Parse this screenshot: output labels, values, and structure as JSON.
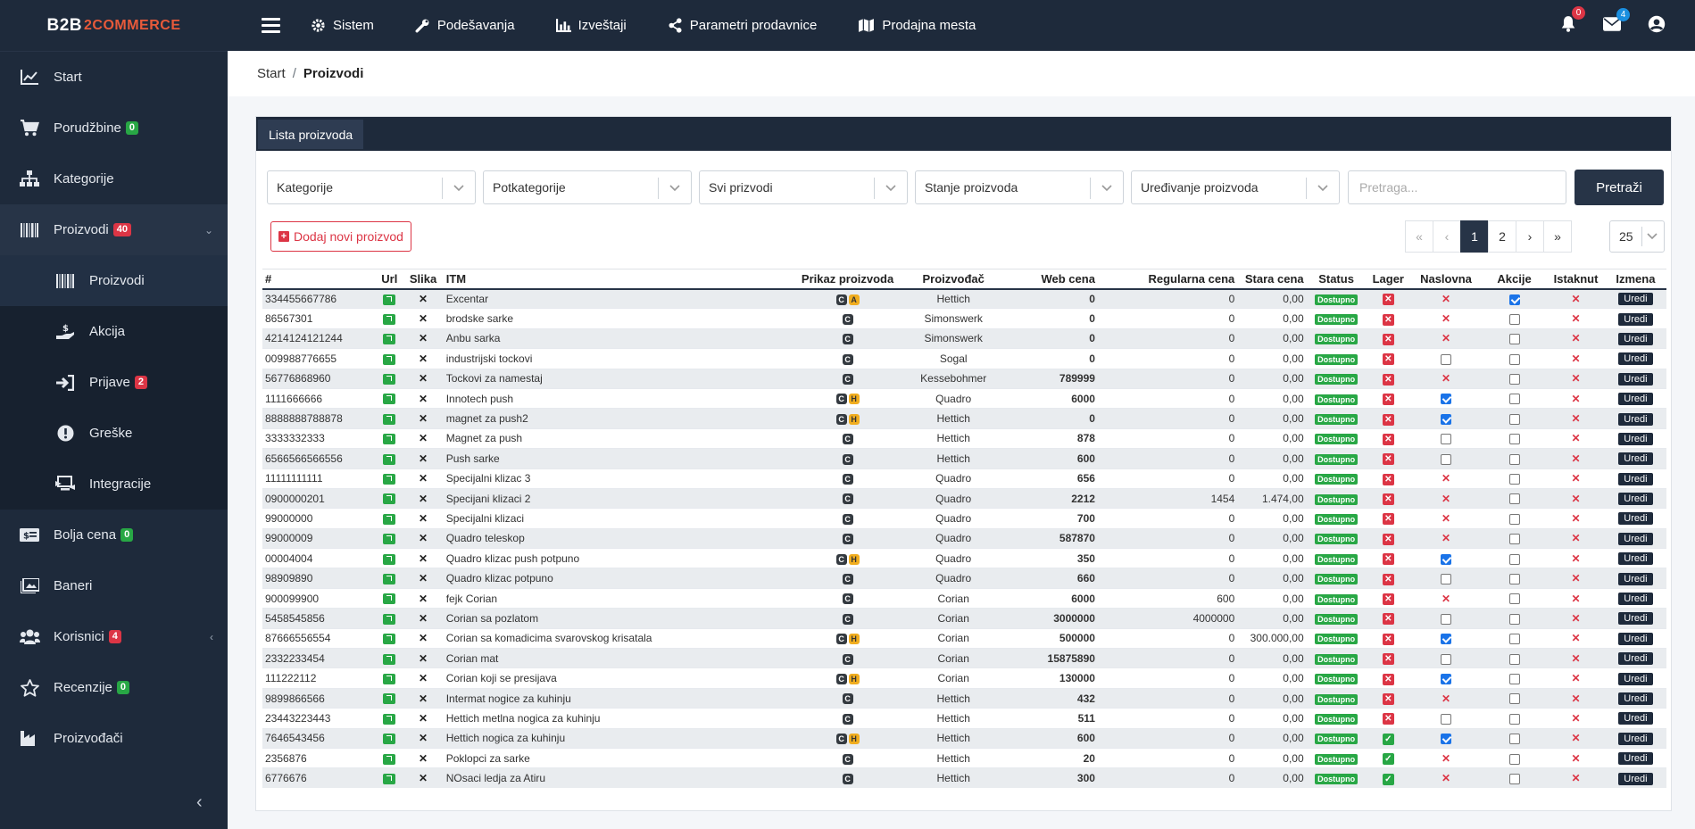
{
  "brand": {
    "part1": "B2B",
    "part2": "2COMMERCE"
  },
  "sidebar": {
    "items": [
      {
        "label": "Start",
        "icon": "chart-line-icon",
        "badge": null
      },
      {
        "label": "Porudžbine",
        "icon": "cart-icon",
        "badge": "0",
        "badge_color": "green"
      },
      {
        "label": "Kategorije",
        "icon": "sitemap-icon",
        "badge": null
      },
      {
        "label": "Proizvodi",
        "icon": "barcode-icon",
        "badge": "40",
        "badge_color": "red"
      },
      {
        "label": "Proizvodi",
        "icon": "barcode-icon",
        "badge": null
      },
      {
        "label": "Akcija",
        "icon": "hand-dollar-icon",
        "badge": null
      },
      {
        "label": "Prijave",
        "icon": "sign-in-icon",
        "badge": "2",
        "badge_color": "red"
      },
      {
        "label": "Greške",
        "icon": "exclamation-icon",
        "badge": null
      },
      {
        "label": "Integracije",
        "icon": "integration-icon",
        "badge": null
      },
      {
        "label": "Bolja cena",
        "icon": "money-icon",
        "badge": "0",
        "badge_color": "green"
      },
      {
        "label": "Baneri",
        "icon": "image-icon",
        "badge": null
      },
      {
        "label": "Korisnici",
        "icon": "users-icon",
        "badge": "4",
        "badge_color": "red"
      },
      {
        "label": "Recenzije",
        "icon": "star-icon",
        "badge": "0",
        "badge_color": "green"
      },
      {
        "label": "Proizvođači",
        "icon": "factory-icon",
        "badge": null
      }
    ]
  },
  "topbar": {
    "menu": [
      "Sistem",
      "Podešavanja",
      "Izveštaji",
      "Parametri prodavnice",
      "Prodajna mesta"
    ],
    "notifications_count": "0",
    "messages_count": "4"
  },
  "breadcrumb": {
    "home": "Start",
    "current": "Proizvodi"
  },
  "card": {
    "tab": "Lista proizvoda"
  },
  "filters": {
    "kategorije": "Kategorije",
    "potkategorije": "Potkategorije",
    "prikaz": "Svi prizvodi",
    "stanje": "Stanje proizvoda",
    "uredjivanje": "Uređivanje proizvoda",
    "search_placeholder": "Pretraga...",
    "search_button": "Pretraži"
  },
  "add_button": "Dodaj novi proizvod",
  "pagination": {
    "first": "«",
    "prev": "‹",
    "pages": [
      "1",
      "2"
    ],
    "next": "›",
    "last": "»",
    "page_size": "25"
  },
  "table": {
    "headers": [
      "#",
      "Url",
      "Slika",
      "ITM",
      "Prikaz proizvoda",
      "Proizvođač",
      "Web cena",
      "Regularna cena",
      "Stara cena",
      "Status",
      "Lager",
      "Naslovna",
      "Akcije",
      "Istaknut",
      "Izmena"
    ],
    "status_label": "Dostupno",
    "edit_label": "Uredi",
    "rows": [
      {
        "id": "334455667786",
        "name": "Excentar",
        "prikaz": [
          "C",
          "A"
        ],
        "man": "Hettich",
        "web": "0",
        "reg": "0",
        "old": "0,00",
        "lager": false,
        "nasl": "x",
        "akc": true,
        "ist": "x",
        "link": false
      },
      {
        "id": "86567301",
        "name": "brodske sarke",
        "prikaz": [
          "C"
        ],
        "man": "Simonswerk",
        "web": "0",
        "reg": "0",
        "old": "0,00",
        "lager": false,
        "nasl": "x",
        "akc": false,
        "ist": "x",
        "link": true
      },
      {
        "id": "4214124121244",
        "name": "Anbu sarka",
        "prikaz": [
          "C"
        ],
        "man": "Simonswerk",
        "web": "0",
        "reg": "0",
        "old": "0,00",
        "lager": false,
        "nasl": "x",
        "akc": false,
        "ist": "x",
        "link": false
      },
      {
        "id": "009988776655",
        "name": "industrijski tockovi",
        "prikaz": [
          "C"
        ],
        "man": "Sogal",
        "web": "0",
        "reg": "0",
        "old": "0,00",
        "lager": false,
        "nasl": "empty",
        "akc": false,
        "ist": "x",
        "link": true
      },
      {
        "id": "56776868960",
        "name": "Tockovi za namestaj",
        "prikaz": [
          "C"
        ],
        "man": "Kessebohmer",
        "web": "789999",
        "reg": "0",
        "old": "0,00",
        "lager": false,
        "nasl": "x",
        "akc": false,
        "ist": "x",
        "link": false
      },
      {
        "id": "1111666666",
        "name": "Innotech push",
        "prikaz": [
          "C",
          "H"
        ],
        "man": "Quadro",
        "web": "6000",
        "reg": "0",
        "old": "0,00",
        "lager": false,
        "nasl": "on",
        "akc": false,
        "ist": "x",
        "link": true
      },
      {
        "id": "8888888788878",
        "name": "magnet za push2",
        "prikaz": [
          "C",
          "H"
        ],
        "man": "Hettich",
        "web": "0",
        "reg": "0",
        "old": "0,00",
        "lager": false,
        "nasl": "on",
        "akc": false,
        "ist": "x",
        "link": false
      },
      {
        "id": "3333332333",
        "name": "Magnet za push",
        "prikaz": [
          "C"
        ],
        "man": "Hettich",
        "web": "878",
        "reg": "0",
        "old": "0,00",
        "lager": false,
        "nasl": "empty",
        "akc": false,
        "ist": "x",
        "link": true
      },
      {
        "id": "6566566566556",
        "name": "Push sarke",
        "prikaz": [
          "C"
        ],
        "man": "Hettich",
        "web": "600",
        "reg": "0",
        "old": "0,00",
        "lager": false,
        "nasl": "empty",
        "akc": false,
        "ist": "x",
        "link": false
      },
      {
        "id": "11111111111",
        "name": "Specijalni klizac 3",
        "prikaz": [
          "C"
        ],
        "man": "Quadro",
        "web": "656",
        "reg": "0",
        "old": "0,00",
        "lager": false,
        "nasl": "x",
        "akc": false,
        "ist": "x",
        "link": true
      },
      {
        "id": "0900000201",
        "name": "Specijani klizaci 2",
        "prikaz": [
          "C"
        ],
        "man": "Quadro",
        "web": "2212",
        "reg": "1454",
        "old": "1.474,00",
        "lager": false,
        "nasl": "x",
        "akc": false,
        "ist": "x",
        "link": false
      },
      {
        "id": "99000000",
        "name": "Specijalni klizaci",
        "prikaz": [
          "C"
        ],
        "man": "Quadro",
        "web": "700",
        "reg": "0",
        "old": "0,00",
        "lager": false,
        "nasl": "x",
        "akc": false,
        "ist": "x",
        "link": true
      },
      {
        "id": "99000009",
        "name": "Quadro teleskop",
        "prikaz": [
          "C"
        ],
        "man": "Quadro",
        "web": "587870",
        "reg": "0",
        "old": "0,00",
        "lager": false,
        "nasl": "x",
        "akc": false,
        "ist": "x",
        "link": false
      },
      {
        "id": "00004004",
        "name": "Quadro klizac push potpuno",
        "prikaz": [
          "C",
          "H"
        ],
        "man": "Quadro",
        "web": "350",
        "reg": "0",
        "old": "0,00",
        "lager": false,
        "nasl": "on",
        "akc": false,
        "ist": "x",
        "link": true
      },
      {
        "id": "98909890",
        "name": "Quadro klizac potpuno",
        "prikaz": [
          "C"
        ],
        "man": "Quadro",
        "web": "660",
        "reg": "0",
        "old": "0,00",
        "lager": false,
        "nasl": "empty",
        "akc": false,
        "ist": "x",
        "link": false
      },
      {
        "id": "900099900",
        "name": "fejk Corian",
        "prikaz": [
          "C"
        ],
        "man": "Corian",
        "web": "6000",
        "reg": "600",
        "old": "0,00",
        "lager": false,
        "nasl": "x",
        "akc": false,
        "ist": "x",
        "link": true
      },
      {
        "id": "5458545856",
        "name": "Corian sa pozlatom",
        "prikaz": [
          "C"
        ],
        "man": "Corian",
        "web": "3000000",
        "reg": "4000000",
        "old": "0,00",
        "lager": false,
        "nasl": "empty",
        "akc": false,
        "ist": "x",
        "link": false
      },
      {
        "id": "87666556554",
        "name": "Corian sa komadicima svarovskog krisatala",
        "prikaz": [
          "C",
          "H"
        ],
        "man": "Corian",
        "web": "500000",
        "reg": "0",
        "old": "300.000,00",
        "lager": false,
        "nasl": "on",
        "akc": false,
        "ist": "x",
        "link": true
      },
      {
        "id": "2332233454",
        "name": "Corian mat",
        "prikaz": [
          "C"
        ],
        "man": "Corian",
        "web": "15875890",
        "reg": "0",
        "old": "0,00",
        "lager": false,
        "nasl": "empty",
        "akc": false,
        "ist": "x",
        "link": false
      },
      {
        "id": "111222112",
        "name": "Corian koji se presijava",
        "prikaz": [
          "C",
          "H"
        ],
        "man": "Corian",
        "web": "130000",
        "reg": "0",
        "old": "0,00",
        "lager": false,
        "nasl": "on",
        "akc": false,
        "ist": "x",
        "link": true
      },
      {
        "id": "9899866566",
        "name": "Intermat nogice za kuhinju",
        "prikaz": [
          "C"
        ],
        "man": "Hettich",
        "web": "432",
        "reg": "0",
        "old": "0,00",
        "lager": false,
        "nasl": "x",
        "akc": false,
        "ist": "x",
        "link": false
      },
      {
        "id": "23443223443",
        "name": "Hettich metlna nogica za kuhinju",
        "prikaz": [
          "C"
        ],
        "man": "Hettich",
        "web": "511",
        "reg": "0",
        "old": "0,00",
        "lager": false,
        "nasl": "empty",
        "akc": false,
        "ist": "x",
        "link": true
      },
      {
        "id": "7646543456",
        "name": "Hettich nogica za kuhinju",
        "prikaz": [
          "C",
          "H"
        ],
        "man": "Hettich",
        "web": "600",
        "reg": "0",
        "old": "0,00",
        "lager": true,
        "nasl": "on",
        "akc": false,
        "ist": "x",
        "link": false
      },
      {
        "id": "2356876",
        "name": "Poklopci za sarke",
        "prikaz": [
          "C"
        ],
        "man": "Hettich",
        "web": "20",
        "reg": "0",
        "old": "0,00",
        "lager": true,
        "nasl": "x",
        "akc": false,
        "ist": "x",
        "link": true
      },
      {
        "id": "6776676",
        "name": "NOsaci ledja za Atiru",
        "prikaz": [
          "C"
        ],
        "man": "Hettich",
        "web": "300",
        "reg": "0",
        "old": "0,00",
        "lager": true,
        "nasl": "x",
        "akc": false,
        "ist": "x",
        "link": false
      }
    ]
  },
  "colors": {
    "sidebar": "#1e2a3b",
    "accent": "#273447",
    "success": "#28a745",
    "danger": "#dc3545",
    "warning": "#f0ad1f"
  }
}
